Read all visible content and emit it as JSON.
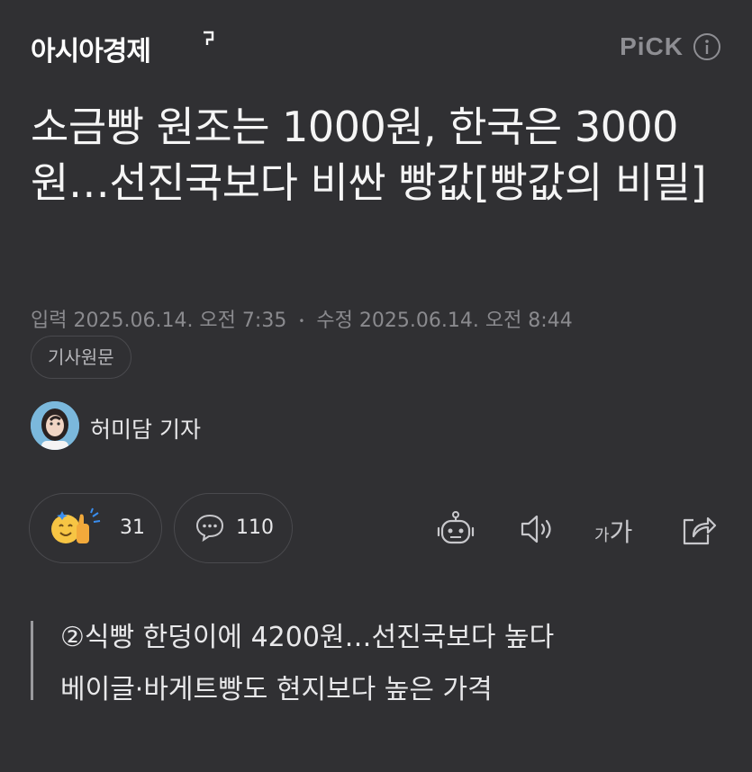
{
  "header": {
    "logo": "아시아경제",
    "pick": "PiCK"
  },
  "article": {
    "title": "소금빵 원조는 1000원, 한국은 3000원…선진국보다 비싼 빵값[빵값의 비밀]",
    "dates": {
      "input_label": "입력",
      "input_date": "2025.06.14. 오전 7:35",
      "modified_label": "수정",
      "modified_date": "2025.06.14. 오전 8:44"
    },
    "original_button": "기사원문",
    "author": "허미담 기자",
    "reactions": {
      "count": "31"
    },
    "comments": {
      "count": "110"
    },
    "font_size_label": "가가",
    "quote": [
      "②식빵 한덩이에 4200원…선진국보다 높다",
      "베이글·바게트빵도 현지보다 높은 가격"
    ]
  },
  "colors": {
    "background": "#303033",
    "text": "#f2f2f2",
    "muted": "#8a8a8e",
    "border": "#4a4a4e"
  }
}
